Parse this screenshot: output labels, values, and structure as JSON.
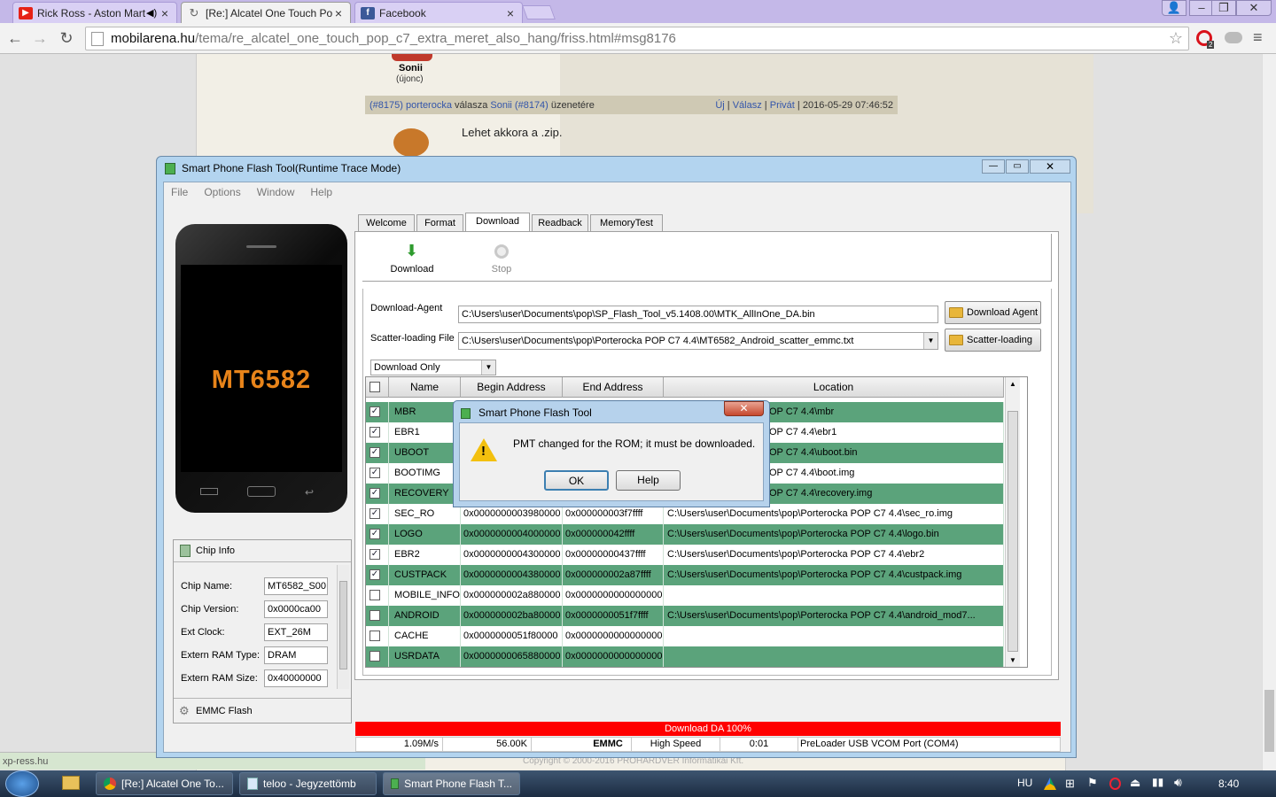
{
  "browser": {
    "tabs": [
      {
        "title": "Rick Ross - Aston Mart",
        "favicon": "youtube-icon",
        "audio": true
      },
      {
        "title": "[Re:] Alcatel One Touch Po",
        "favicon": "loading-icon"
      },
      {
        "title": "Facebook",
        "favicon": "facebook-icon"
      }
    ],
    "url_host": "mobilarena.hu",
    "url_path": "/tema/re_alcatel_one_touch_pop_c7_extra_meret_also_hang/friss.html#msg8176",
    "opera_badge": "2"
  },
  "forum": {
    "user1_name": "Sonii",
    "user1_rank": "(újonc)",
    "reply_header": {
      "ref_self": "(#8175)",
      "author": "porterocka",
      "verb": "válasza",
      "target_user": "Sonii",
      "ref_target": "(#8174)",
      "suffix": "üzenetére",
      "link_new": "Új",
      "link_reply": "Válasz",
      "link_private": "Privát",
      "timestamp": "2016-05-29 07:46:52"
    },
    "post_text": "Lehet akkora a .zip.",
    "footer": "Copyright © 2000-2016 PROHARDVER Informatikai Kft.",
    "status_url": "xp-ress.hu"
  },
  "app": {
    "title": "Smart Phone Flash Tool(Runtime Trace Mode)",
    "menu": [
      "File",
      "Options",
      "Window",
      "Help"
    ],
    "tabs": [
      "Welcome",
      "Format",
      "Download",
      "Readback",
      "MemoryTest"
    ],
    "active_tab": "Download",
    "download_label": "Download",
    "stop_label": "Stop",
    "da_label": "Download-Agent",
    "da_path": "C:\\Users\\user\\Documents\\pop\\SP_Flash_Tool_v5.1408.00\\MTK_AllInOne_DA.bin",
    "da_button": "Download Agent",
    "scatter_label": "Scatter-loading File",
    "scatter_path": "C:\\Users\\user\\Documents\\pop\\Porterocka POP C7 4.4\\MT6582_Android_scatter_emmc.txt",
    "scatter_button": "Scatter-loading",
    "mode": "Download Only",
    "columns": [
      "Name",
      "Begin Address",
      "End Address",
      "Location"
    ],
    "rows": [
      {
        "checked": true,
        "name": "MBR",
        "begin": "",
        "end": "",
        "location": "nents\\pop\\Porterocka POP C7 4.4\\mbr"
      },
      {
        "checked": true,
        "name": "EBR1",
        "begin": "",
        "end": "",
        "location": "nents\\pop\\Porterocka POP C7 4.4\\ebr1"
      },
      {
        "checked": true,
        "name": "UBOOT",
        "begin": "",
        "end": "",
        "location": "nents\\pop\\Porterocka POP C7 4.4\\uboot.bin"
      },
      {
        "checked": true,
        "name": "BOOTIMG",
        "begin": "",
        "end": "",
        "location": "nents\\pop\\Porterocka POP C7 4.4\\boot.img"
      },
      {
        "checked": true,
        "name": "RECOVERY",
        "begin": "",
        "end": "",
        "location": "nents\\pop\\Porterocka POP C7 4.4\\recovery.img"
      },
      {
        "checked": true,
        "name": "SEC_RO",
        "begin": "0x0000000003980000",
        "end": "0x000000003f7ffff",
        "location": "C:\\Users\\user\\Documents\\pop\\Porterocka POP C7 4.4\\sec_ro.img"
      },
      {
        "checked": true,
        "name": "LOGO",
        "begin": "0x0000000004000000",
        "end": "0x000000042ffff",
        "location": "C:\\Users\\user\\Documents\\pop\\Porterocka POP C7 4.4\\logo.bin"
      },
      {
        "checked": true,
        "name": "EBR2",
        "begin": "0x0000000004300000",
        "end": "0x00000000437ffff",
        "location": "C:\\Users\\user\\Documents\\pop\\Porterocka POP C7 4.4\\ebr2"
      },
      {
        "checked": true,
        "name": "CUSTPACK",
        "begin": "0x0000000004380000",
        "end": "0x000000002a87ffff",
        "location": "C:\\Users\\user\\Documents\\pop\\Porterocka POP C7 4.4\\custpack.img"
      },
      {
        "checked": false,
        "name": "MOBILE_INFO",
        "begin": "0x000000002a880000",
        "end": "0x0000000000000000",
        "location": ""
      },
      {
        "checked": false,
        "name": "ANDROID",
        "begin": "0x000000002ba80000",
        "end": "0x0000000051f7ffff",
        "location": "C:\\Users\\user\\Documents\\pop\\Porterocka POP C7 4.4\\android_mod7..."
      },
      {
        "checked": false,
        "name": "CACHE",
        "begin": "0x0000000051f80000",
        "end": "0x0000000000000000",
        "location": ""
      },
      {
        "checked": false,
        "name": "USRDATA",
        "begin": "0x0000000065880000",
        "end": "0x0000000000000000",
        "location": ""
      }
    ],
    "phone_label": "MT6582",
    "chip_info_title": "Chip Info",
    "chip_fields": [
      {
        "label": "Chip Name:",
        "value": "MT6582_S00"
      },
      {
        "label": "Chip Version:",
        "value": "0x0000ca00"
      },
      {
        "label": "Ext Clock:",
        "value": "EXT_26M"
      },
      {
        "label": "Extern RAM Type:",
        "value": "DRAM"
      },
      {
        "label": "Extern RAM Size:",
        "value": "0x40000000"
      }
    ],
    "emmc_label": "EMMC Flash",
    "progress_text": "Download DA 100%",
    "progress_fraction": 1.0,
    "status": {
      "speed": "1.09M/s",
      "size": "56.00K",
      "storage": "EMMC",
      "speed_mode": "High Speed",
      "time": "0:01",
      "port": "PreLoader USB VCOM Port (COM4)"
    }
  },
  "dialog": {
    "title": "Smart Phone Flash Tool",
    "message": "PMT changed for the ROM; it must be downloaded.",
    "ok": "OK",
    "help": "Help"
  },
  "taskbar": {
    "items": [
      "[Re:] Alcatel One To...",
      "teloo - Jegyzettömb",
      "Smart Phone Flash T..."
    ],
    "lang": "HU",
    "clock": "8:40"
  },
  "colors": {
    "progress": "#ff0000",
    "row_highlight": "#5ba37b",
    "browser_frame": "#c4b8e8"
  }
}
